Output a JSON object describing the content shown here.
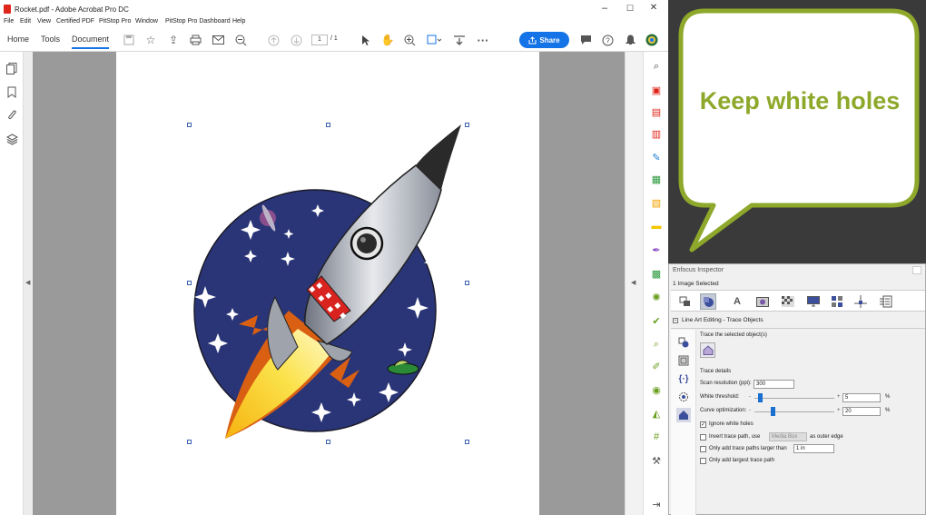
{
  "window": {
    "title": "Rocket.pdf - Adobe Acrobat Pro DC",
    "controls": [
      "–",
      "☐",
      "✕"
    ]
  },
  "menu": [
    "File",
    "Edit",
    "View",
    "Certified PDF",
    "PitStop Pro",
    "Window",
    "PitStop Pro Dashboard",
    "Help"
  ],
  "toolbar": {
    "tabs": [
      "Home",
      "Tools",
      "Document"
    ],
    "active_tab": "Document",
    "page_current": "1",
    "page_total": "/ 1",
    "share_label": "Share",
    "icons": [
      "save-icon",
      "bookmark-star-icon",
      "cloud-upload-icon",
      "print-icon",
      "email-icon",
      "zoom-out-icon",
      "page-up-icon",
      "page-down-icon",
      "pointer-icon",
      "hand-icon",
      "zoom-in-icon",
      "marquee-icon",
      "scroll-icon",
      "more-icon",
      "comment-icon",
      "help-icon",
      "bell-icon",
      "account-icon"
    ]
  },
  "left_nav": [
    "pages-icon",
    "bookmarks-icon",
    "attachments-icon",
    "layers-icon"
  ],
  "right_tools": [
    {
      "name": "zoom-tool-icon",
      "color": "#444444"
    },
    {
      "name": "export-pdf-icon",
      "color": "#e0261b"
    },
    {
      "name": "create-pdf-icon",
      "color": "#e0261b"
    },
    {
      "name": "organize-pages-icon",
      "color": "#e0261b"
    },
    {
      "name": "edit-pdf-icon",
      "color": "#1b7fd4"
    },
    {
      "name": "scan-icon",
      "color": "#2c9a3e"
    },
    {
      "name": "enhance-icon",
      "color": "#f3a300"
    },
    {
      "name": "comment-tool-icon",
      "color": "#f3c600"
    },
    {
      "name": "fill-sign-icon",
      "color": "#8b4bc4"
    },
    {
      "name": "print-production-icon",
      "color": "#2c9a3e"
    },
    {
      "name": "preflight-icon",
      "color": "#6a9e1f"
    },
    {
      "name": "checkmark-icon",
      "color": "#6a9e1f"
    },
    {
      "name": "inspector-icon",
      "color": "#6a9e1f"
    },
    {
      "name": "pen-icon",
      "color": "#6a9e1f"
    },
    {
      "name": "eye-icon",
      "color": "#6a9e1f"
    },
    {
      "name": "fix-icon",
      "color": "#6a9e1f"
    },
    {
      "name": "grid-icon",
      "color": "#6a9e1f"
    },
    {
      "name": "wrench-icon",
      "color": "#555555"
    },
    {
      "name": "collapse-right-icon",
      "color": "#555555"
    }
  ],
  "callout": {
    "text": "Keep white holes",
    "border_color": "#8da82a",
    "text_color": "#8da82a"
  },
  "inspector": {
    "title": "Enfocus Inspector",
    "selection": "1 Image Selected",
    "section": "Line Art Editing - Trace Objects",
    "trace_selected": "Trace the selected object(s)",
    "trace_details": "Trace details",
    "scan_resolution_label": "Scan resolution (ppi):",
    "scan_resolution_value": "300",
    "white_threshold_label": "White threshold:",
    "white_threshold_value": "5",
    "white_threshold_fraction": 0.05,
    "curve_optimization_label": "Curve optimization:",
    "curve_optimization_value": "20",
    "curve_optimization_fraction": 0.2,
    "percent": "%",
    "minus": "-",
    "plus": "+",
    "ignore_white_holes_label": "Ignore white holes",
    "ignore_white_holes_checked": true,
    "invert_trace_label": "Invert trace path, use",
    "invert_trace_value": "Media Box",
    "invert_trace_suffix": "as outer edge",
    "larger_than_label": "Only add trace paths larger than",
    "larger_than_value": "1 in",
    "largest_label": "Only add largest trace path"
  }
}
